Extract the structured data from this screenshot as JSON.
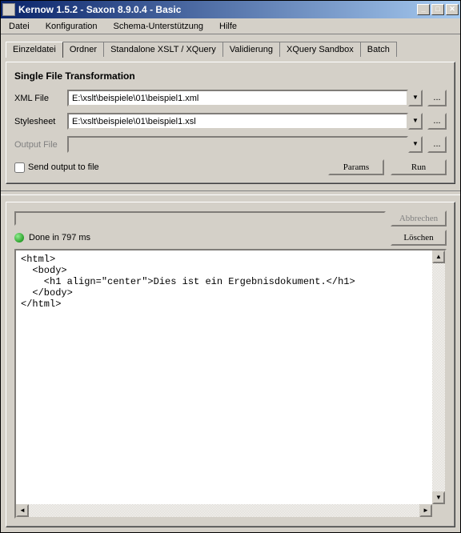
{
  "title": "Kernow 1.5.2 - Saxon 8.9.0.4 - Basic",
  "menu": {
    "datei": "Datei",
    "konfiguration": "Konfiguration",
    "schema": "Schema-Unterstützung",
    "hilfe": "Hilfe"
  },
  "tabs": {
    "einzeldatei": "Einzeldatei",
    "ordner": "Ordner",
    "standalone": "Standalone XSLT / XQuery",
    "validierung": "Validierung",
    "sandbox": "XQuery Sandbox",
    "batch": "Batch"
  },
  "section_title": "Single File Transformation",
  "labels": {
    "xml_file": "XML File",
    "stylesheet": "Stylesheet",
    "output_file": "Output File"
  },
  "fields": {
    "xml_file": "E:\\xslt\\beispiele\\01\\beispiel1.xml",
    "stylesheet": "E:\\xslt\\beispiele\\01\\beispiel1.xsl",
    "output_file": ""
  },
  "checkbox": {
    "send_output": "Send output to file"
  },
  "buttons": {
    "params": "Params",
    "run": "Run",
    "abbrechen": "Abbrechen",
    "loeschen": "Löschen",
    "browse": "..."
  },
  "status": {
    "text": "Done in 797 ms"
  },
  "output": "<html>\n  <body>\n    <h1 align=\"center\">Dies ist ein Ergebnisdokument.</h1>\n  </body>\n</html>"
}
